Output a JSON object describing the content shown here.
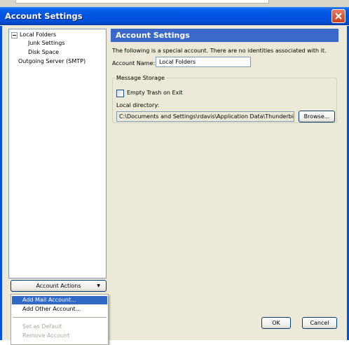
{
  "dialog": {
    "title": "Account Settings",
    "close_label": "close"
  },
  "tree": {
    "items": [
      {
        "label": "Local Folders",
        "expanded": true
      },
      {
        "label": "Junk Settings"
      },
      {
        "label": "Disk Space"
      },
      {
        "label": "Outgoing Server (SMTP)"
      }
    ]
  },
  "account_actions": {
    "label": "Account Actions",
    "menu": [
      {
        "label": "Add Mail Account...",
        "highlighted": true,
        "enabled": true
      },
      {
        "label": "Add Other Account...",
        "enabled": true
      },
      {
        "label": "Set as Default",
        "enabled": false
      },
      {
        "label": "Remove Account",
        "enabled": false
      }
    ]
  },
  "panel": {
    "header": "Account Settings",
    "info_text": "The following is a special account. There are no identities associated with it.",
    "account_name_label": "Account Name:",
    "account_name_value": "Local Folders",
    "message_storage": {
      "legend": "Message Storage",
      "empty_trash_label": "Empty Trash on Exit",
      "empty_trash_checked": false,
      "local_dir_label": "Local directory:",
      "local_dir_value": "C:\\Documents and Settings\\rdavis\\Application Data\\Thunderbird\\Pr",
      "browse_label": "Browse..."
    }
  },
  "footer": {
    "ok_label": "OK",
    "cancel_label": "Cancel"
  },
  "colors": {
    "titlebar": "#0054e3",
    "header_bar": "#3a69c9",
    "menu_highlight": "#316ac5",
    "dialog_bg": "#ece9d8"
  }
}
